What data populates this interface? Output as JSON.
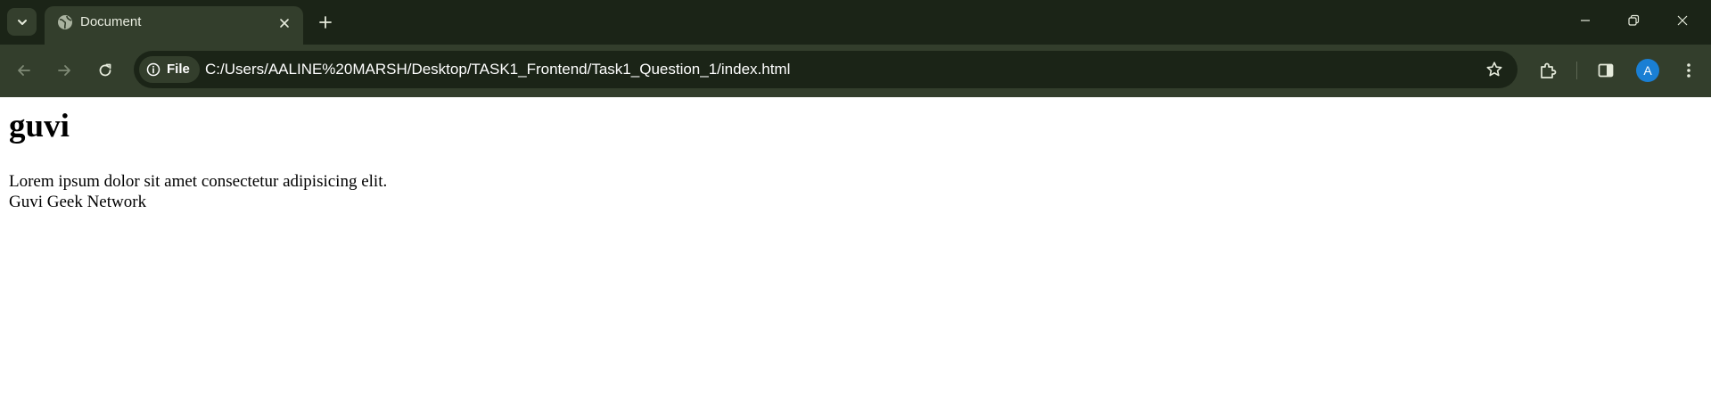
{
  "browser": {
    "tab": {
      "title": "Document",
      "favicon": "globe-icon"
    },
    "toolbar": {
      "security_chip_label": "File",
      "url": "C:/Users/AALINE%20MARSH/Desktop/TASK1_Frontend/Task1_Question_1/index.html",
      "profile_initial": "A"
    },
    "colors": {
      "frame": "#1b2417",
      "toolbar": "#333e2c",
      "avatar": "#1a7fd4"
    }
  },
  "page": {
    "heading": "guvi",
    "paragraph": "Lorem ipsum dolor sit amet consectetur adipisicing elit.",
    "line2": "Guvi Geek Network"
  }
}
